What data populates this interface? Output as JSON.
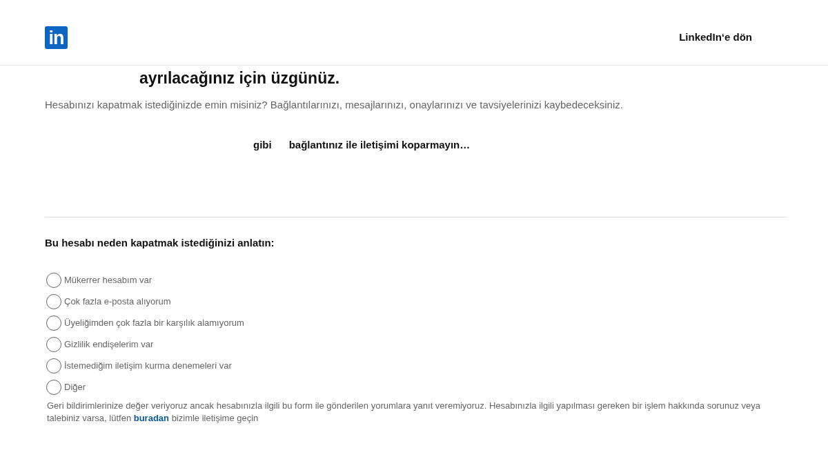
{
  "header": {
    "logo": "in",
    "back_link": "LinkedIn‘e dön"
  },
  "title": "ayrılacağınız için üzgünüz.",
  "warning": "Hesabınızı kapatmak istediğinizde emin misiniz? Bağlantılarınızı, mesajlarınızı, onaylarınızı ve tavsiyelerinizi kaybedeceksiniz.",
  "connections_line": [
    "gibi",
    "bağlantınız ile iletişimi koparmayın…"
  ],
  "question": "Bu hesabı neden kapatmak istediğinizi anlatın:",
  "reasons": [
    {
      "label": "Mükerrer hesabım var",
      "selected": false
    },
    {
      "label": "Çok fazla e-posta alıyorum",
      "selected": false
    },
    {
      "label": "Üyeliğimden çok fazla bir karşılık alamıyorum",
      "selected": false
    },
    {
      "label": "Gizlilik endişelerim var",
      "selected": false
    },
    {
      "label": "İstemediğim iletişim kurma denemeleri var",
      "selected": false
    },
    {
      "label": "Diğer",
      "selected": false
    }
  ],
  "footer_note": {
    "before": "Geri bildirimlerinize değer veriyoruz ancak hesabınızla ilgili bu form ile gönderilen yorumlara yanıt veremiyoruz. Hesabınızla ilgili yapılması gereken bir işlem hakkında sorunuz veya talebiniz varsa, lütfen",
    "link": "buradan",
    "after": "bizimle iletişime geçin"
  }
}
